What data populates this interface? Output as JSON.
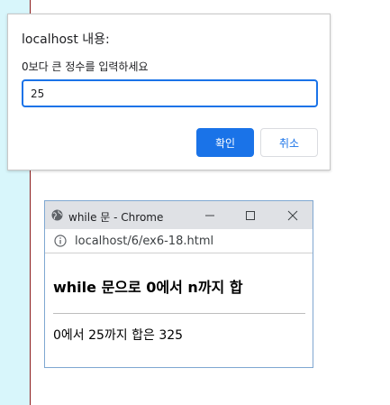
{
  "dialog": {
    "title": "localhost 내용:",
    "message": "0보다 큰 정수를 입력하세요",
    "input_value": "25",
    "ok_label": "확인",
    "cancel_label": "취소"
  },
  "browser_window": {
    "title": "while 문 - Chrome",
    "url": "localhost/6/ex6-18.html",
    "icons": {
      "favicon": "globe-icon",
      "info": "info-icon",
      "minimize": "minimize-icon",
      "maximize": "maximize-icon",
      "close": "close-icon"
    }
  },
  "page": {
    "heading": "while 문으로 0에서 n까지 합",
    "result": "0에서 25까지 합은 325"
  },
  "colors": {
    "accent": "#1a73e8",
    "side_strip": "#d8f6fb",
    "side_strip_border": "#8b1a1a"
  }
}
